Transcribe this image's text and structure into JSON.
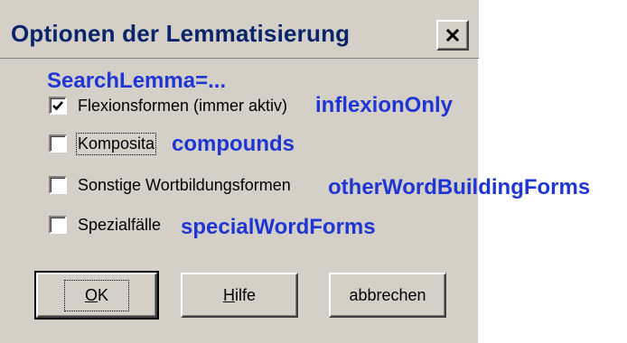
{
  "window": {
    "title": "Optionen der Lemmatisierung",
    "close_label": "×"
  },
  "annotations": {
    "search_lemma": "SearchLemma=...",
    "inflexion_only": "inflexionOnly",
    "compounds": "compounds",
    "other_word_building_forms": "otherWordBuildingForms",
    "special_word_forms": "specialWordForms"
  },
  "options": [
    {
      "label": "Flexionsformen (immer aktiv)",
      "checked": true
    },
    {
      "label": "Komposita",
      "checked": false
    },
    {
      "label": "Sonstige Wortbildungsformen",
      "checked": false
    },
    {
      "label": "Spezialfälle",
      "checked": false
    }
  ],
  "buttons": {
    "ok": {
      "mnemonic": "O",
      "rest": "K"
    },
    "help": {
      "mnemonic": "H",
      "rest": "ilfe"
    },
    "cancel": {
      "label": "abbrechen"
    }
  },
  "colors": {
    "dialog_bg": "#d4d0c8",
    "title_text": "#0a246a",
    "annotation_text": "#1f36d4"
  }
}
